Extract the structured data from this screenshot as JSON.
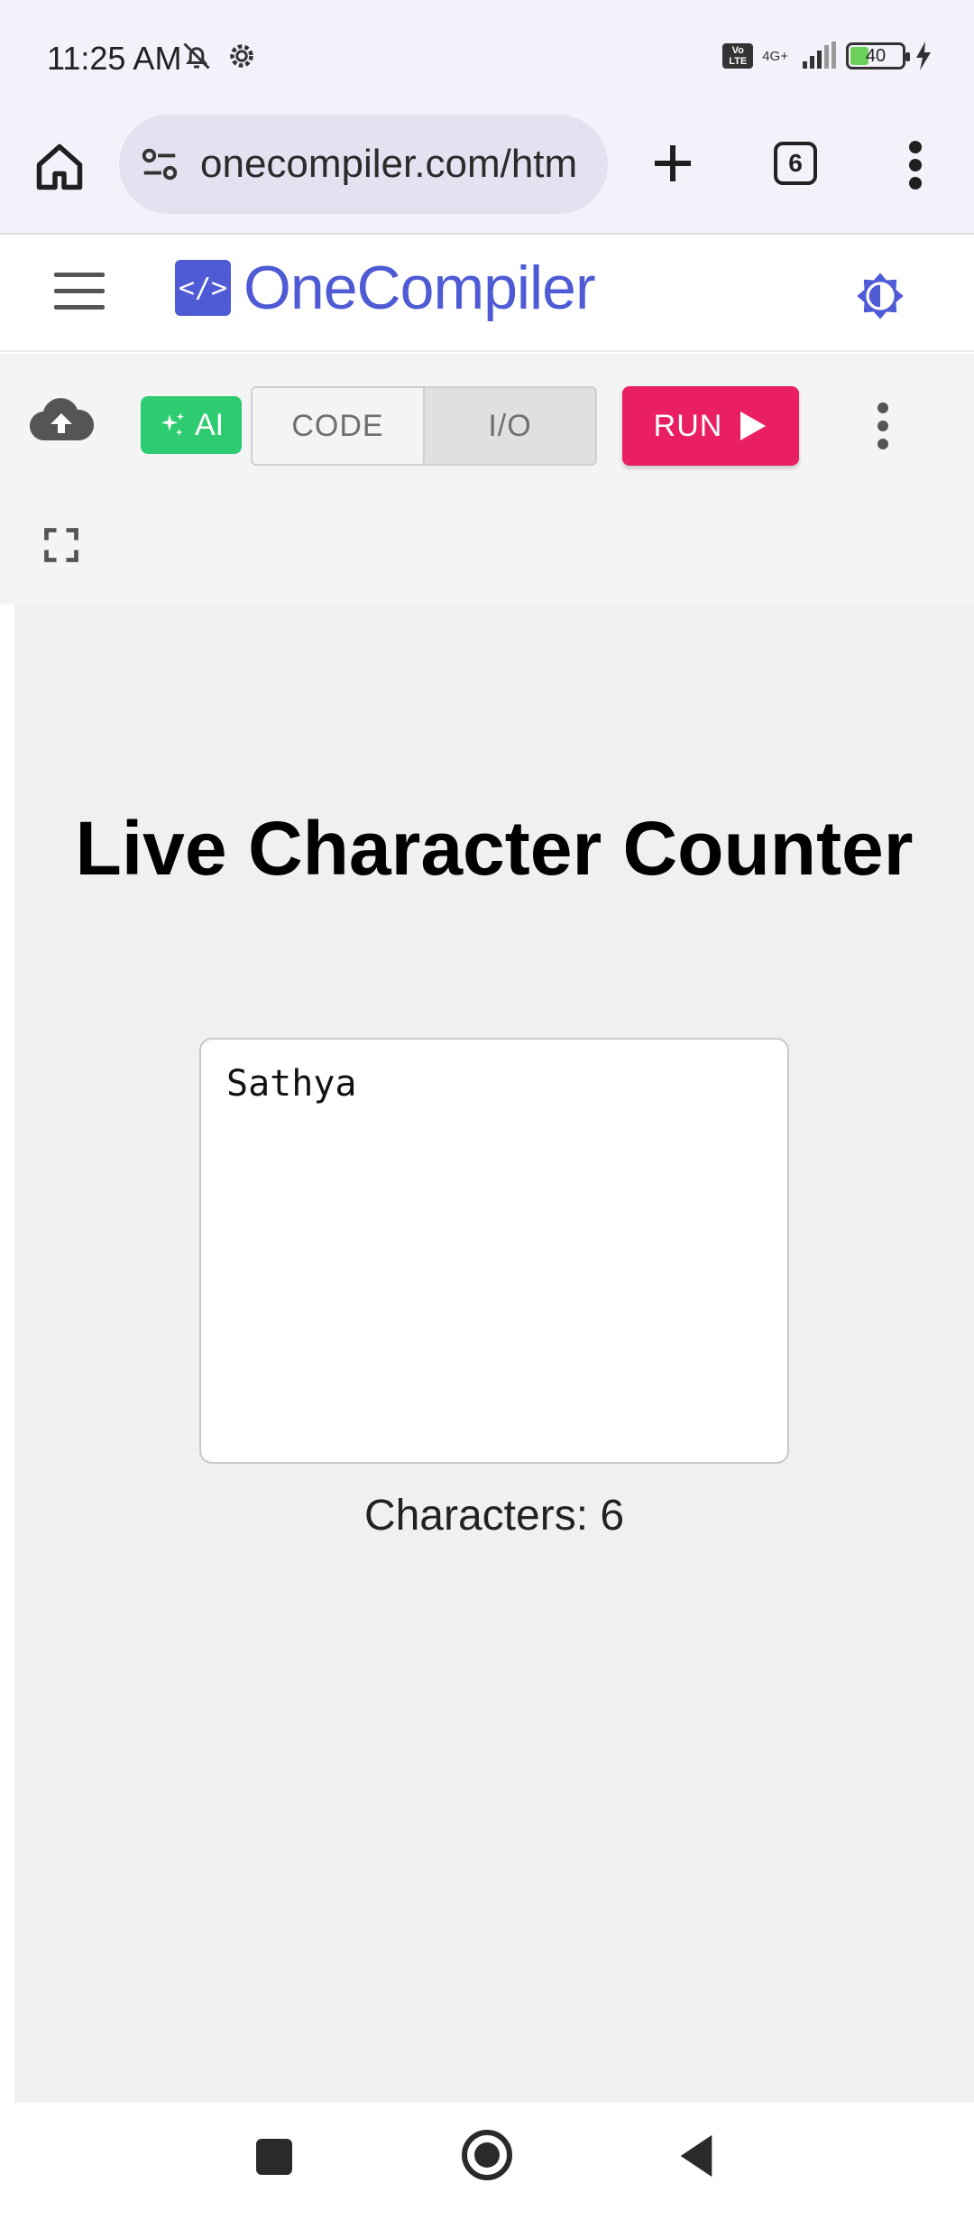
{
  "status_bar": {
    "time": "11:25 AM",
    "network": "4G+",
    "volte": "Vo LTE",
    "battery": "40",
    "icons": [
      "bell-off-icon",
      "settings-gear-icon",
      "signal-icon",
      "charging-bolt-icon"
    ]
  },
  "browser": {
    "url": "onecompiler.com/htm",
    "tab_count": "6",
    "icons": [
      "home-icon",
      "site-settings-icon",
      "new-tab-plus-icon",
      "more-vert-icon"
    ]
  },
  "header": {
    "logo_mark": "</>",
    "brand": "OneCompiler",
    "brand_color": "#4f5bd5",
    "theme_icon": "brightness-icon"
  },
  "toolbar": {
    "ai_label": "AI",
    "code_tab": "CODE",
    "io_tab": "I/O",
    "active_tab": "I/O",
    "run_label": "RUN",
    "run_color": "#e91e63",
    "ai_color": "#2ecc71",
    "icons": [
      "cloud-upload-icon",
      "sparkle-icon",
      "play-icon",
      "more-vert-icon",
      "fullscreen-icon"
    ]
  },
  "output": {
    "title": "Live Character Counter",
    "textarea_value": "Sathya",
    "counter_text": "Characters: 6"
  },
  "navbar": {
    "icons": [
      "recents-icon",
      "home-icon",
      "back-icon"
    ]
  }
}
